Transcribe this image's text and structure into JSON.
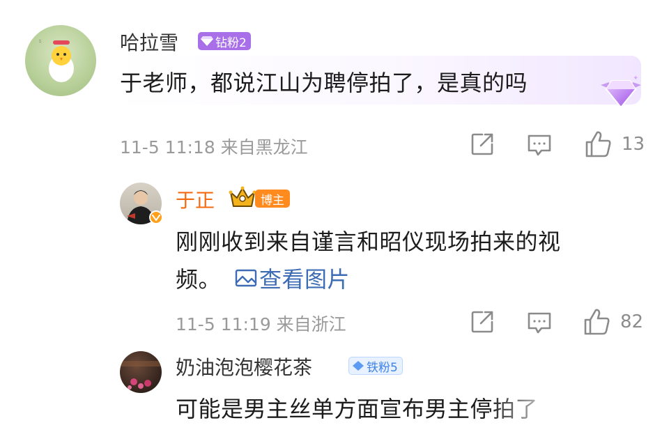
{
  "comments": [
    {
      "username": "哈拉雪",
      "badge": "钻粉2",
      "text": "于老师，都说江山为聘停拍了，是真的吗",
      "meta": "11-5 11:18 来自黑龙江",
      "likes": "13"
    },
    {
      "username": "于正",
      "badge": "博主",
      "text_line1": "刚刚收到来自谨言和昭仪现场拍来的视",
      "text_line2": "频。",
      "link": "查看图片",
      "meta": "11-5 11:19 来自浙江",
      "likes": "82"
    },
    {
      "username": "奶油泡泡樱花茶",
      "badge": "铁粉5",
      "text": "可能是男主丝单方面宣布男主停拍了"
    }
  ],
  "colors": {
    "badge_diamond": "#a86fe8",
    "badge_blogger": "#ff8a1e",
    "badge_iron": "#5b9cf2",
    "link": "#3d6cb5",
    "author_name": "#f36a10"
  },
  "icons": [
    "share-icon",
    "comment-icon",
    "like-icon",
    "image-icon",
    "crown-icon",
    "verified-icon",
    "gem-icon"
  ]
}
